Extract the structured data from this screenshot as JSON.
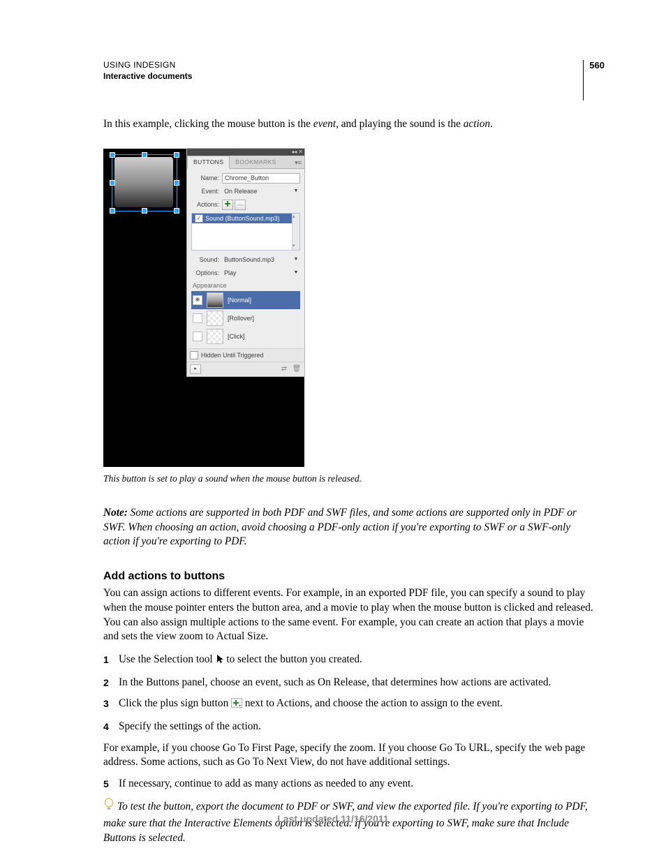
{
  "header": {
    "line1": "USING INDESIGN",
    "line2": "Interactive documents",
    "page_number": "560"
  },
  "intro": {
    "prefix": "In this example, clicking the mouse button is the ",
    "event_word": "event",
    "mid": ", and playing the sound is the ",
    "action_word": "action",
    "suffix": "."
  },
  "figure": {
    "panel": {
      "tabs": {
        "buttons": "BUTTONS",
        "bookmarks": "BOOKMARKS"
      },
      "name_label": "Name:",
      "name_value": "Chrome_Button",
      "event_label": "Event:",
      "event_value": "On Release",
      "actions_label": "Actions:",
      "action_item": "Sound (ButtonSound.mp3)",
      "sound_label": "Sound:",
      "sound_value": "ButtonSound.mp3",
      "options_label": "Options:",
      "options_value": "Play",
      "appearance_label": "Appearance",
      "state_normal": "[Normal]",
      "state_rollover": "[Rollover]",
      "state_click": "[Click]",
      "hidden_label": "Hidden Until Triggered"
    },
    "caption": "This button is set to play a sound when the mouse button is released."
  },
  "note": {
    "label": "Note:",
    "text": " Some actions are supported in both PDF and SWF files, and some actions are supported only in PDF or SWF. When choosing an action, avoid choosing a PDF-only action if you're exporting to SWF or a SWF-only action if you're exporting to PDF."
  },
  "section_title": "Add actions to buttons",
  "section_intro": "You can assign actions to different events. For example, in an exported PDF file, you can specify a sound to play when the mouse pointer enters the button area, and a movie to play when the mouse button is clicked and released. You can also assign multiple actions to the same event. For example, you can create an action that plays a movie and sets the view zoom to Actual Size.",
  "steps": {
    "s1a": "Use the Selection tool ",
    "s1b": " to select the button you created.",
    "s2": "In the Buttons panel, choose an event, such as On Release, that determines how actions are activated.",
    "s3a": "Click the plus sign button ",
    "s3b": " next to Actions, and choose the action to assign to the event.",
    "s4": "Specify the settings of the action.",
    "s5": "If necessary, continue to add as many actions as needed to any event."
  },
  "after_step4": "For example, if you choose Go To First Page, specify the zoom. If you choose Go To URL, specify the web page address. Some actions, such as Go To Next View, do not have additional settings.",
  "tip": "To test the button, export the document to PDF or SWF, and view the exported file. If you're exporting to PDF, make sure that the Interactive Elements option is selected. If you're exporting to SWF, make sure that Include Buttons is selected.",
  "footer": "Last updated 11/16/2011"
}
